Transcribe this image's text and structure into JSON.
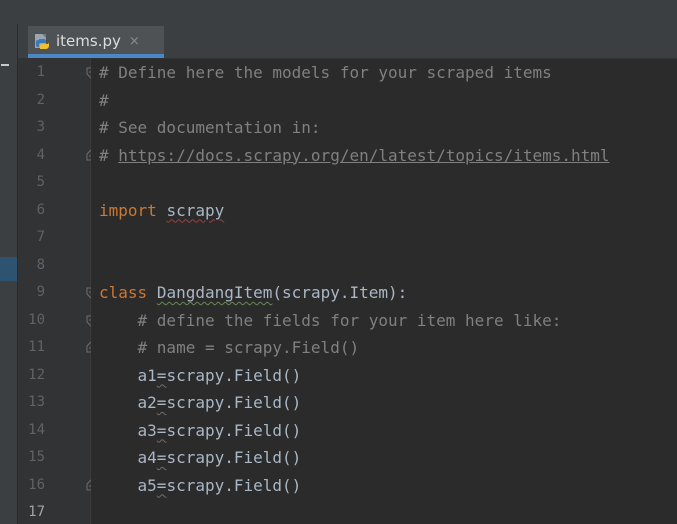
{
  "tab": {
    "file_name": "items.py",
    "close_glyph": "×",
    "icon": "python-file-icon"
  },
  "gutter": {
    "line_numbers": [
      "1",
      "2",
      "3",
      "4",
      "5",
      "6",
      "7",
      "8",
      "9",
      "10",
      "11",
      "12",
      "13",
      "14",
      "15",
      "16",
      "17"
    ],
    "current_line": "17"
  },
  "code": {
    "line1": "# Define here the models for your scraped items",
    "line2": "#",
    "line3": "# See documentation in:",
    "line4_prefix": "# ",
    "line4_link": "https://docs.scrapy.org/en/latest/topics/items.html",
    "line6_kw": "import",
    "line6_mod": "scrapy",
    "line9_kw": "class",
    "line9_name": "DangdangItem",
    "line9_rest": "(scrapy.Item):",
    "line10": "    # define the fields for your item here like:",
    "line11": "    # name = scrapy.Field()",
    "fields": [
      {
        "name": "a1",
        "eq": "=",
        "value": "scrapy.Field()"
      },
      {
        "name": "a2",
        "eq": "=",
        "value": "scrapy.Field()"
      },
      {
        "name": "a3",
        "eq": "=",
        "value": "scrapy.Field()"
      },
      {
        "name": "a4",
        "eq": "=",
        "value": "scrapy.Field()"
      },
      {
        "name": "a5",
        "eq": "=",
        "value": "scrapy.Field()"
      }
    ]
  },
  "colors": {
    "background": "#2b2b2b",
    "gutter": "#313335",
    "comment": "#808080",
    "keyword": "#cc7832",
    "text": "#a9b7c6",
    "tab_accent": "#4a88c7"
  }
}
